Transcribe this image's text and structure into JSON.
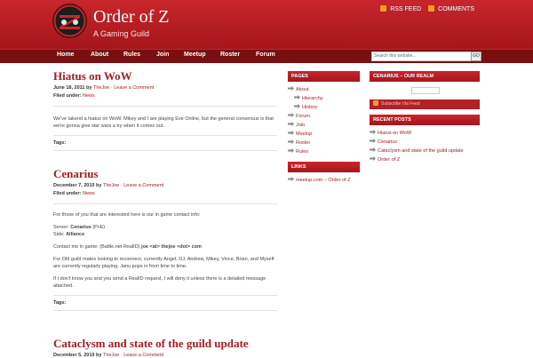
{
  "header": {
    "site_title": "Order of Z",
    "site_description": "A Gaming Guild",
    "rss_feed": "RSS FEED",
    "comments": "COMMENTS"
  },
  "nav": {
    "items": [
      "Home",
      "About",
      "Rules",
      "Join",
      "Meetup",
      "Roster",
      "Forum"
    ]
  },
  "search": {
    "placeholder": "Search this website...",
    "button": "GO"
  },
  "posts": [
    {
      "title": "Hiatus on WoW",
      "date": "June 18, 2011",
      "by": "by",
      "author": "TheJoe",
      "sep": "·",
      "comment_link": "Leave a Comment",
      "filed_under_label": "Filed under:",
      "category": "News",
      "body": "We've takend a hiatus on WoW.  Mikey and I are playing Eve Online, but the general consensus is that we're gonna give star wars a try when it comes out.",
      "tags_label": "Tags:"
    },
    {
      "title": "Cenarius",
      "date": "December 7, 2010",
      "by": "by",
      "author": "TheJoe",
      "sep": "·",
      "comment_link": "Leave a Comment",
      "filed_under_label": "Filed under:",
      "category": "News",
      "intro": "For those of you that are interested here is our in game contact info:",
      "server_label": "Server:",
      "server_name": "Cenarius",
      "server_type": "(PvE)",
      "side_label": "Side:",
      "side_value": "Alliance",
      "contact_label": "Contact me in game:  (Battle.net RealID)",
      "contact_value": "joe <at> thejoe <dot> com",
      "old_guild": "For Old guild mates looking to reconnect, currently Angel, DJ, Andrew, Mikey, Vince, Brian, and Myself are currently regularly playing.  Janu pops in from time to time.",
      "realid": "If I don't know you and you send a RealID request, I will deny it unless there is a detailed message attached.",
      "tags_label": "Tags:"
    },
    {
      "title": "Cataclysm and state of the guild update",
      "date": "December 5, 2010",
      "by": "by",
      "author": "TheJoe",
      "sep": "·",
      "comment_link": "Leave a Comment"
    }
  ],
  "sidebar_left": {
    "pages_heading": "PAGES",
    "pages": [
      {
        "label": "About",
        "sub": false
      },
      {
        "label": "Hierarchy",
        "sub": true
      },
      {
        "label": "History",
        "sub": true
      },
      {
        "label": "Forum",
        "sub": false
      },
      {
        "label": "Join",
        "sub": false
      },
      {
        "label": "Meetup",
        "sub": false
      },
      {
        "label": "Roster",
        "sub": false
      },
      {
        "label": "Rules",
        "sub": false
      }
    ],
    "links_heading": "LINKS",
    "links": [
      "meetup.com – Order of Z"
    ]
  },
  "sidebar_right": {
    "realm_heading": "CENARIUS – OUR REALM",
    "subscribe_label": "Subscribe Via Feed",
    "recent_heading": "RECENT POSTS",
    "recent": [
      "Hiatus on WoW",
      "Cenarius",
      "Cataclysm and state of the guild update",
      "Order of Z"
    ]
  },
  "colors": {
    "brand_red": "#b01a20",
    "nav_dark": "#7a0f12",
    "rss_orange": "#f39a2b"
  }
}
